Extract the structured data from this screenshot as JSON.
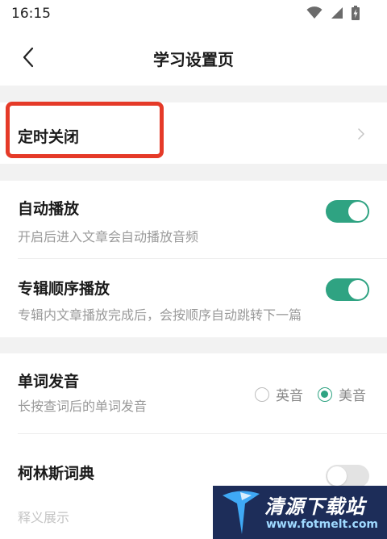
{
  "status_bar": {
    "time": "16:15"
  },
  "header": {
    "title": "学习设置页"
  },
  "settings": {
    "timer_close": {
      "title": "定时关闭"
    },
    "auto_play": {
      "title": "自动播放",
      "desc": "开启后进入文章会自动播放音频",
      "enabled": true
    },
    "album_order": {
      "title": "专辑顺序播放",
      "desc": "专辑内文章播放完成后，会按顺序自动跳转下一篇",
      "enabled": true
    },
    "word_pronunciation": {
      "title": "单词发音",
      "desc": "长按查词后的单词发音",
      "options": [
        "英音",
        "美音"
      ],
      "selected": "美音"
    },
    "collins": {
      "title": "柯林斯词典",
      "desc": "释义展示",
      "enabled": false
    }
  },
  "watermark": {
    "text": "清源下载站",
    "url": "www.fotmelt.com"
  },
  "colors": {
    "accent": "#2fa382",
    "highlight": "#e53a28"
  },
  "icons": [
    "wifi-icon",
    "signal-icon",
    "battery-icon",
    "back-arrow-icon",
    "chevron-right-icon"
  ]
}
